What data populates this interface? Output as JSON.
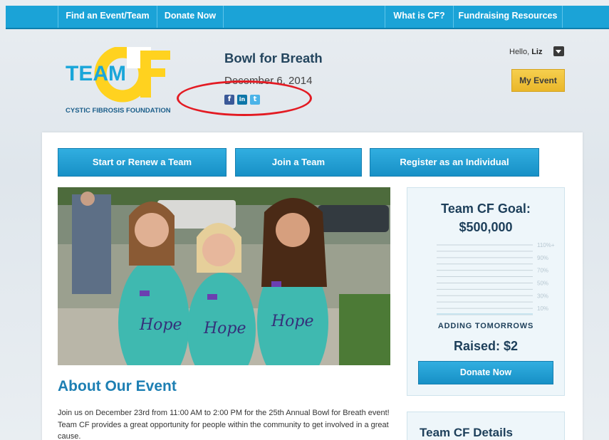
{
  "nav": {
    "left": [
      "Find an Event/Team",
      "Donate Now"
    ],
    "right": [
      "What is CF?",
      "Fundraising Resources"
    ]
  },
  "logo": {
    "team_text": "TEAM",
    "cf_text": "CF",
    "tagline": "CYSTIC FIBROSIS FOUNDATION"
  },
  "event": {
    "title": "Bowl for Breath",
    "date": "December 6, 2014",
    "social": [
      {
        "icon": "facebook-icon",
        "glyph": "f",
        "color": "#3b5998"
      },
      {
        "icon": "linkedin-icon",
        "glyph": "in",
        "color": "#0e76a8"
      },
      {
        "icon": "twitter-icon",
        "glyph": "t",
        "color": "#4ab3e8"
      }
    ]
  },
  "user": {
    "hello_prefix": "Hello,",
    "name": "Liz",
    "my_event_label": "My Event"
  },
  "actions": {
    "start_team": "Start or Renew a Team",
    "join_team": "Join a Team",
    "register_individual": "Register as an Individual"
  },
  "photo": {
    "shirt_text": "Hope"
  },
  "about": {
    "title": "About Our Event",
    "text": "Join us on December 23rd from 11:00 AM to 2:00 PM for the 25th Annual Bowl for Breath event! Team CF provides a great opportunity for people within the community to get involved in a great cause."
  },
  "goal": {
    "title": "Team CF Goal:",
    "amount": "$500,000",
    "progress_fraction": 0.0,
    "scale_labels": [
      "110%+",
      "90%",
      "70%",
      "50%",
      "30%",
      "10%"
    ],
    "tagline": "ADDING TOMORROWS",
    "raised": "Raised: $2",
    "donate_label": "Donate Now"
  },
  "details": {
    "title": "Team CF Details"
  },
  "colors": {
    "nav_blue": "#1ba3d7",
    "brand_blue": "#1d7fb3",
    "logo_yellow": "#ffd21f",
    "logo_blue": "#1aa6d9",
    "highlight_red": "#e31b23"
  }
}
